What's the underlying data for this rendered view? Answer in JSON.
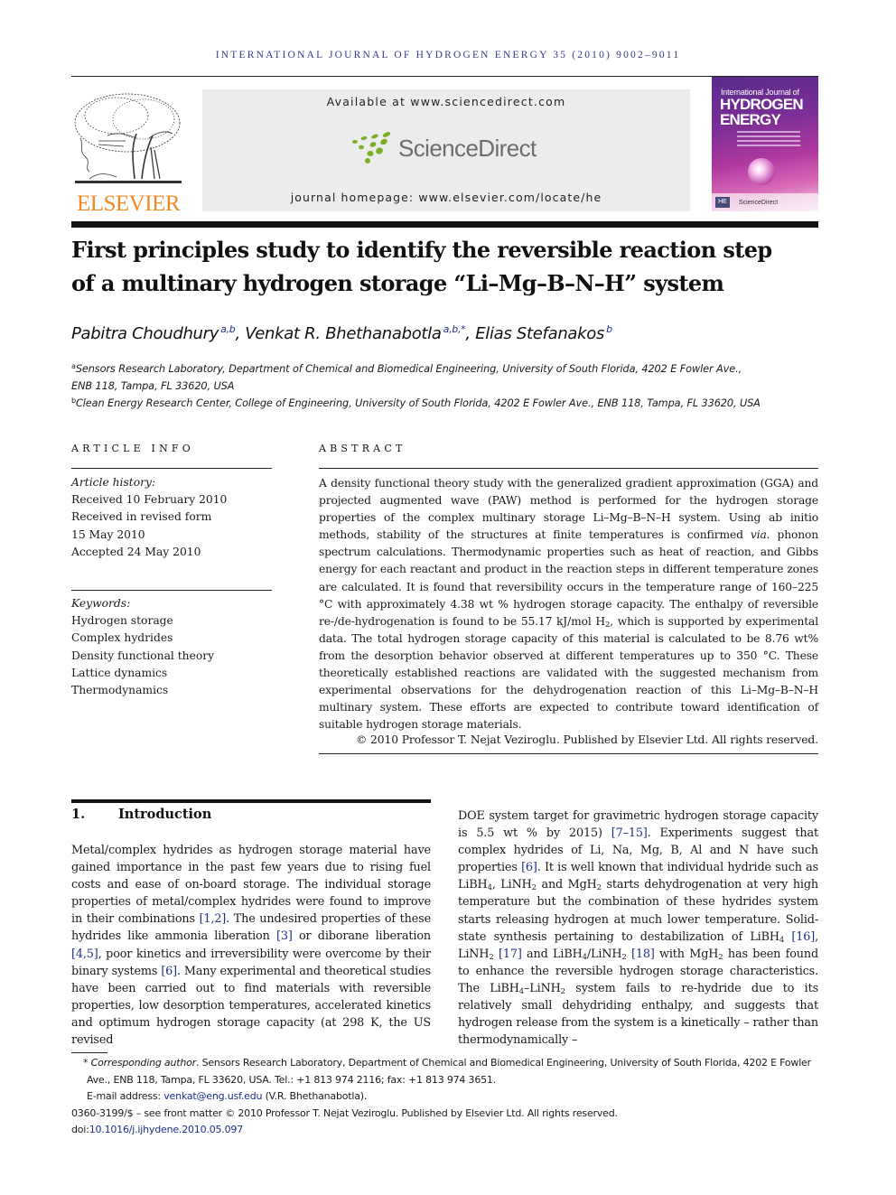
{
  "running_head": "INTERNATIONAL JOURNAL OF HYDROGEN ENERGY 35 (2010) 9002–9011",
  "masthead": {
    "publisher_logo_text": "ELSEVIER",
    "available_at": "Available at www.sciencedirect.com",
    "sciencedirect_logo_text": "ScienceDirect",
    "journal_homepage": "journal homepage: www.elsevier.com/locate/he",
    "cover": {
      "line1": "International Journal of",
      "line2": "HYDROGEN",
      "line3": "ENERGY",
      "badge": "HE",
      "footer_logo": "ScienceDirect"
    },
    "colors": {
      "elsevier_orange": "#f08a24",
      "sciencedirect_green": "#7bb026",
      "link_blue": "#1d2e86"
    }
  },
  "title_line1": "First principles study to identify the reversible reaction step",
  "title_line2": "of a multinary hydrogen storage “Li–Mg–B–N–H” system",
  "authors": [
    {
      "name": "Pabitra Choudhury",
      "affil": "a,b"
    },
    {
      "name": "Venkat R. Bhethanabotla",
      "affil": "a,b,*"
    },
    {
      "name": "Elias Stefanakos",
      "affil": "b"
    }
  ],
  "affiliations": [
    {
      "key": "a",
      "line1": "Sensors Research Laboratory, Department of Chemical and Biomedical Engineering, University of South Florida, 4202 E Fowler Ave.,",
      "line2": "ENB 118, Tampa, FL 33620, USA"
    },
    {
      "key": "b",
      "line1": "Clean Energy Research Center, College of Engineering, University of South Florida, 4202 E Fowler Ave., ENB 118, Tampa, FL 33620, USA"
    }
  ],
  "article_info": {
    "heading": "ARTICLE INFO",
    "history_label": "Article history:",
    "history": [
      "Received 10 February 2010",
      "Received in revised form",
      "15 May 2010",
      "Accepted 24 May 2010"
    ],
    "keywords_label": "Keywords:",
    "keywords": [
      "Hydrogen storage",
      "Complex hydrides",
      "Density functional theory",
      "Lattice dynamics",
      "Thermodynamics"
    ]
  },
  "abstract": {
    "heading": "ABSTRACT",
    "p1": "A density functional theory study with the generalized gradient approximation (GGA) and projected augmented wave (PAW) method is performed for the hydrogen storage properties of the complex multinary storage Li–Mg–B–N–H system. Using ab initio methods, stability of the structures at finite temperatures is confirmed ",
    "via": "via",
    "p2": ". phonon spectrum calculations. Thermodynamic properties such as heat of reaction, and Gibbs energy for each reactant and product in the reaction steps in different temperature zones are calculated. It is found that reversibility occurs in the temperature range of 160–225 °C with approximately 4.38 wt % hydrogen storage capacity. The enthalpy of reversible re-/de-hydrogenation is found to be 55.17 kJ/mol H",
    "p2_sub": "2",
    "p3": ", which is supported by experimental data. The total hydrogen storage capacity of this material is calculated to be 8.76 wt% from the desorption behavior observed at different temperatures up to 350 °C. These theoretically established reactions are validated with the suggested mechanism from experimental observations for the dehydrogenation reaction of this Li–Mg–B–N–H multinary system. These efforts are expected to contribute toward identification of suitable hydrogen storage materials.",
    "copyright": "© 2010 Professor T. Nejat Veziroglu. Published by Elsevier Ltd. All rights reserved."
  },
  "intro": {
    "number": "1.",
    "heading": "Introduction",
    "left": [
      "Metal/complex hydrides as hydrogen storage material have gained importance in the past few years due to rising fuel costs and ease of on-board storage. The individual storage properties of metal/complex hydrides were found to improve in their combinations ",
      "[1,2]",
      ". The undesired properties of these hydrides like ammonia liberation ",
      "[3]",
      " or diborane liberation ",
      "[4,5]",
      ", poor kinetics and irreversibility were overcome by their binary systems ",
      "[6]",
      ". Many experimental and theoretical studies have been carried out to find materials with reversible properties, low desorption temperatures, accelerated kinetics and optimum hydrogen storage capacity (at 298 K, the US revised"
    ],
    "right": {
      "t1": "DOE system target for gravimetric hydrogen storage capacity is 5.5 wt % by 2015) ",
      "r1": "[7–15]",
      "t2": ". Experiments suggest that complex hydrides of Li, Na, Mg, B, Al and N have such properties ",
      "r2": "[6]",
      "t3": ". It is well known that individual hydride such as LiBH",
      "t4": ", LiNH",
      "t5": " and MgH",
      "t6": " starts dehydrogenation at very high temperature but the combination of these hydrides system starts releasing hydrogen at much lower temperature. Solid-state synthesis pertaining to destabilization of LiBH",
      "r3": "[16]",
      "t7": ", LiNH",
      "r4": "[17]",
      "t8": " and LiBH",
      "t9": "/LiNH",
      "r5": "[18]",
      "t10": " with MgH",
      "t11": " has been found to enhance the reversible hydrogen storage characteristics. The LiBH",
      "t12": "–LiNH",
      "t13": " system fails to re-hydride due to its relatively small dehydriding enthalpy, and suggests that hydrogen release from the system is a kinetically – rather than thermodynamically –",
      "sub4": "4",
      "sub2": "2"
    }
  },
  "footnotes": {
    "corr_label": "* Corresponding author",
    "corr_text": ". Sensors Research Laboratory, Department of Chemical and Biomedical Engineering, University of South Florida, 4202 E Fowler Ave., ENB 118, Tampa, FL 33620, USA. Tel.: +1 813 974 2116; fax: +1 813 974 3651.",
    "email_label": "E-mail address: ",
    "email": "venkat@eng.usf.edu",
    "email_owner": " (V.R. Bhethanabotla).",
    "front_matter": "0360-3199/$ – see front matter © 2010 Professor T. Nejat Veziroglu. Published by Elsevier Ltd. All rights reserved.",
    "doi_label": "doi:",
    "doi": "10.1016/j.ijhydene.2010.05.097"
  }
}
